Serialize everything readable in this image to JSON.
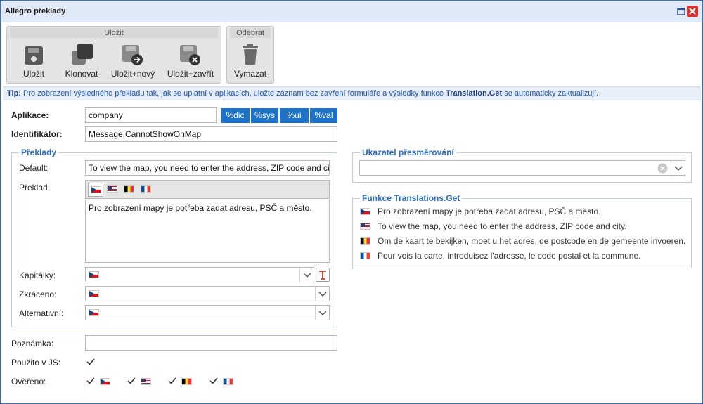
{
  "window": {
    "title": "Allegro překlady"
  },
  "ribbon": {
    "save_group": {
      "label": "Uložit",
      "buttons": [
        {
          "label": "Uložit",
          "icon": "floppy-disk-icon"
        },
        {
          "label": "Klonovat",
          "icon": "clone-icon"
        },
        {
          "label": "Uložit+nový",
          "icon": "save-new-icon"
        },
        {
          "label": "Uložit+zavřít",
          "icon": "save-close-icon"
        }
      ]
    },
    "remove_group": {
      "label": "Odebrat",
      "buttons": [
        {
          "label": "Vymazat",
          "icon": "trash-icon"
        }
      ]
    }
  },
  "tip": {
    "prefix": "Tip:",
    "text": " Pro zobrazení výsledného překladu tak, jak se uplatní v aplikacích, uložte záznam bez zavření formuláře a výsledky funkce ",
    "func": "Translation.Get",
    "suffix": " se automaticky zaktualizují."
  },
  "form": {
    "application": {
      "label": "Aplikace:",
      "value": "company"
    },
    "macros": [
      "%dic",
      "%sys",
      "%ui",
      "%val"
    ],
    "identifier": {
      "label": "Identifikátor:",
      "value": "Message.CannotShowOnMap"
    },
    "translations": {
      "legend": "Překlady",
      "default": {
        "label": "Default:",
        "value": "To view the map, you need to enter the address, ZIP code and city."
      },
      "translation": {
        "label": "Překlad:",
        "value": "Pro zobrazení mapy je potřeba zadat adresu, PSČ a město."
      },
      "flags": [
        "cz",
        "us",
        "be",
        "fr"
      ],
      "capitals": {
        "label": "Kapitálky:"
      },
      "short": {
        "label": "Zkráceno:"
      },
      "alternative": {
        "label": "Alternativní:"
      }
    },
    "note": {
      "label": "Poznámka:",
      "value": ""
    },
    "used_in_js": {
      "label": "Použito v JS:",
      "checked": true
    },
    "verified": {
      "label": "Ověřeno:",
      "items": [
        {
          "flag": "cz",
          "checked": true
        },
        {
          "flag": "us",
          "checked": true
        },
        {
          "flag": "be",
          "checked": true
        },
        {
          "flag": "fr",
          "checked": true
        }
      ]
    }
  },
  "redirect": {
    "legend": "Ukazatel přesměrování",
    "value": ""
  },
  "functions": {
    "legend": "Funkce Translations.Get",
    "rows": [
      {
        "flag": "cz",
        "text": "Pro zobrazení mapy je potřeba zadat adresu, PSČ a město."
      },
      {
        "flag": "us",
        "text": "To view the map, you need to enter the address, ZIP code and city."
      },
      {
        "flag": "be",
        "text": "Om de kaart te bekijken, moet u het adres, de postcode en de gemeente invoeren."
      },
      {
        "flag": "fr",
        "text": "Pour vois la carte, introduisez l'adresse, le code postal et la commune."
      }
    ]
  },
  "colors": {
    "accent": "#1e73c8",
    "legend": "#2b6cc4",
    "close": "#d9302c"
  }
}
